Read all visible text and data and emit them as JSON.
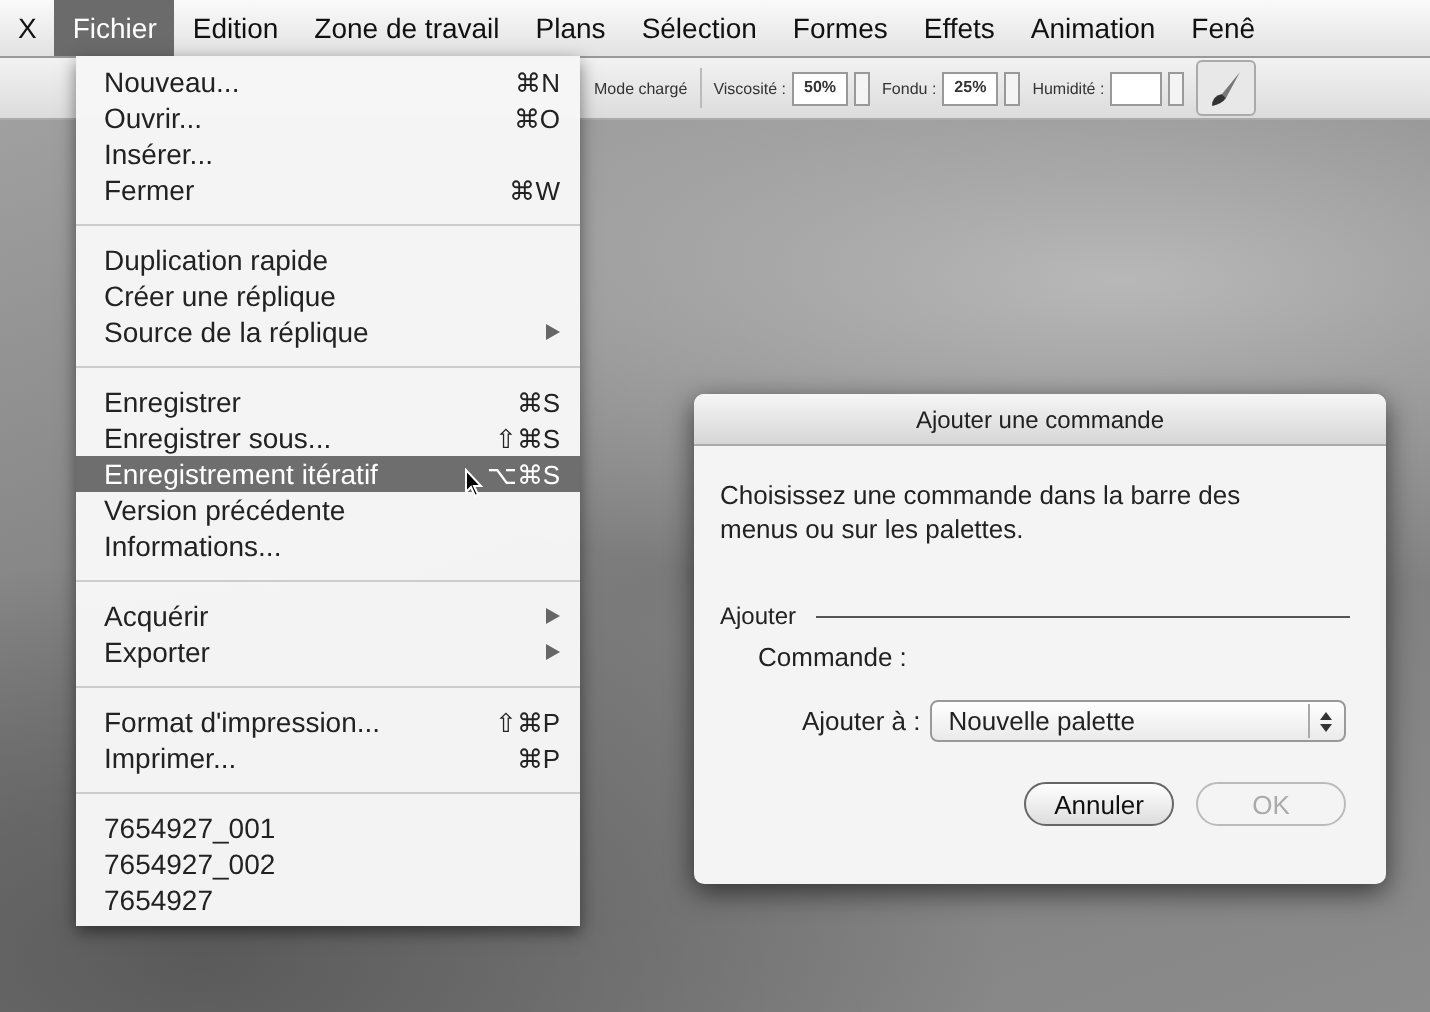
{
  "menubar": {
    "items": [
      {
        "label": "X",
        "selected": false
      },
      {
        "label": "Fichier",
        "selected": true
      },
      {
        "label": "Edition",
        "selected": false
      },
      {
        "label": "Zone de travail",
        "selected": false
      },
      {
        "label": "Plans",
        "selected": false
      },
      {
        "label": "Sélection",
        "selected": false
      },
      {
        "label": "Formes",
        "selected": false
      },
      {
        "label": "Effets",
        "selected": false
      },
      {
        "label": "Animation",
        "selected": false
      },
      {
        "label": "Fenê",
        "selected": false
      }
    ]
  },
  "toolbar": {
    "mode": "Mode chargé",
    "fields": [
      {
        "label": "Viscosité :",
        "value": "50%"
      },
      {
        "label": "Fondu :",
        "value": "25%"
      },
      {
        "label": "Humidité :"
      }
    ]
  },
  "menu": {
    "sections": [
      [
        {
          "label": "Nouveau...",
          "shortcut": "⌘N",
          "submenu": false,
          "selected": false
        },
        {
          "label": "Ouvrir...",
          "shortcut": "⌘O",
          "submenu": false,
          "selected": false
        },
        {
          "label": "Insérer...",
          "submenu": false,
          "selected": false
        },
        {
          "label": "Fermer",
          "shortcut": "⌘W",
          "submenu": false,
          "selected": false
        }
      ],
      [
        {
          "label": "Duplication rapide",
          "submenu": false,
          "selected": false
        },
        {
          "label": "Créer une réplique",
          "submenu": false,
          "selected": false
        },
        {
          "label": "Source de la réplique",
          "submenu": true,
          "selected": false
        }
      ],
      [
        {
          "label": "Enregistrer",
          "shortcut": "⌘S",
          "submenu": false,
          "selected": false
        },
        {
          "label": "Enregistrer sous...",
          "shortcut": "⇧⌘S",
          "submenu": false,
          "selected": false
        },
        {
          "label": "Enregistrement itératif",
          "shortcut": "⌥⌘S",
          "submenu": false,
          "selected": true
        },
        {
          "label": "Version précédente",
          "submenu": false,
          "selected": false
        },
        {
          "label": "Informations...",
          "submenu": false,
          "selected": false
        }
      ],
      [
        {
          "label": "Acquérir",
          "submenu": true,
          "selected": false
        },
        {
          "label": "Exporter",
          "submenu": true,
          "selected": false
        }
      ],
      [
        {
          "label": "Format d'impression...",
          "shortcut": "⇧⌘P",
          "submenu": false,
          "selected": false
        },
        {
          "label": "Imprimer...",
          "shortcut": "⌘P",
          "submenu": false,
          "selected": false
        }
      ],
      [
        {
          "label": "7654927_001",
          "submenu": false,
          "selected": false
        },
        {
          "label": "7654927_002",
          "submenu": false,
          "selected": false
        },
        {
          "label": "7654927",
          "submenu": false,
          "selected": false
        }
      ]
    ]
  },
  "dialog": {
    "title": "Ajouter une commande",
    "message": "Choisissez une commande dans la barre des menus ou sur les palettes.",
    "group": "Ajouter",
    "command_label": "Commande :",
    "target_label": "Ajouter à :",
    "target_value": "Nouvelle palette",
    "buttons": [
      {
        "label": "Annuler",
        "disabled": false
      },
      {
        "label": "OK",
        "disabled": true
      }
    ]
  }
}
